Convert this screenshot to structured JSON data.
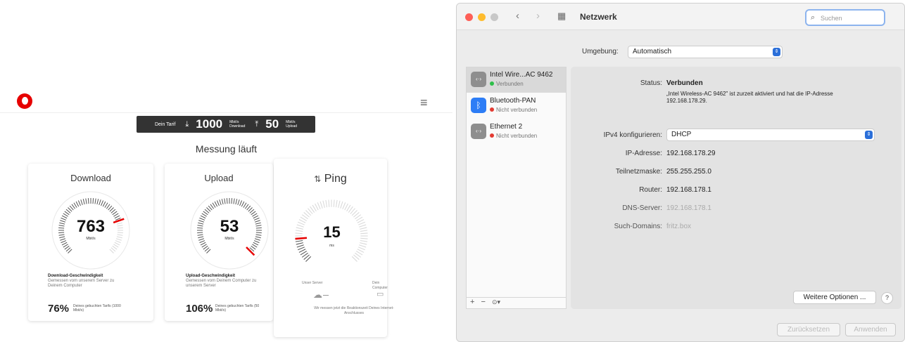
{
  "speedtest": {
    "tarif": {
      "label": "Dein Tarif",
      "down": "1000",
      "down_unit": "Mbit/s",
      "down_label": "Download",
      "up": "50",
      "up_unit": "Mbit/s",
      "up_label": "Upload"
    },
    "status": "Messung läuft",
    "download": {
      "title": "Download",
      "value": "763",
      "unit": "Mbit/s",
      "caption_title": "Download-Geschwindigkeit",
      "caption": "Gemessen vom unserem Server zu Deinem Computer",
      "pct": "76%",
      "pct_text": "Deines gebuchten Tarifs (1000 Mbit/s)",
      "fraction": 0.763
    },
    "upload": {
      "title": "Upload",
      "value": "53",
      "unit": "Mbit/s",
      "caption_title": "Upload-Geschwindigkeit",
      "caption": "Gemessen vom Deinem Computer zu unserem Server",
      "pct": "106%",
      "pct_text": "Deines gebuchten Tarifs (50 Mbit/s)",
      "fraction": 1.0
    },
    "ping": {
      "title": "Ping",
      "value": "15",
      "unit": "ms",
      "server": "Unser Server",
      "computer": "Dein Computer",
      "text": "Wir messen jetzt die Reaktionszeit Deines Internet-Anschlusses",
      "fraction": 0.15
    }
  },
  "window": {
    "title": "Netzwerk",
    "search_placeholder": "Suchen",
    "umgebung_label": "Umgebung:",
    "umgebung_value": "Automatisch",
    "services": [
      {
        "name": "Intel Wire...AC 9462",
        "status": "Verbunden",
        "status_color": "#2fbf4a"
      },
      {
        "name": "Bluetooth-PAN",
        "status": "Nicht verbunden",
        "status_color": "#e33b32"
      },
      {
        "name": "Ethernet 2",
        "status": "Nicht verbunden",
        "status_color": "#e33b32"
      }
    ],
    "sidebar_controls": {
      "add": "+",
      "remove": "−",
      "action": "⊙▾"
    },
    "status_label": "Status:",
    "status_value": "Verbunden",
    "status_desc": "„Intel Wireless-AC 9462\" ist zurzeit aktiviert und hat die IP-Adresse 192.168.178.29.",
    "ipv4_label": "IPv4 konfigurieren:",
    "ipv4_value": "DHCP",
    "fields": [
      {
        "label": "IP-Adresse:",
        "value": "192.168.178.29",
        "dim": false
      },
      {
        "label": "Teilnetzmaske:",
        "value": "255.255.255.0",
        "dim": false
      },
      {
        "label": "Router:",
        "value": "192.168.178.1",
        "dim": false
      },
      {
        "label": "DNS-Server:",
        "value": "192.168.178.1",
        "dim": true
      },
      {
        "label": "Such-Domains:",
        "value": "fritz.box",
        "dim": true
      }
    ],
    "more_options": "Weitere Optionen ...",
    "help": "?",
    "revert": "Zurücksetzen",
    "apply": "Anwenden"
  }
}
